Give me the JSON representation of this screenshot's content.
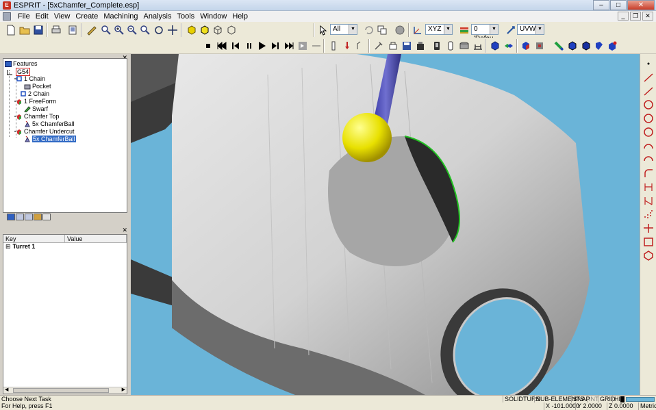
{
  "window": {
    "title": "ESPRIT - [5xChamfer_Complete.esp]",
    "app_icon": "E"
  },
  "menu": [
    "File",
    "Edit",
    "View",
    "Create",
    "Machining",
    "Analysis",
    "Tools",
    "Window",
    "Help"
  ],
  "toolbar1": {
    "select_filter": "All",
    "plane": "XYZ",
    "layer": "0 'Defau",
    "work_coord": "UVW"
  },
  "features_panel": {
    "title": "Features",
    "items": [
      {
        "label": "G54",
        "level": 0,
        "icon": "csys-icon"
      },
      {
        "label": "1 Chain",
        "level": 1,
        "icon": "chain-icon"
      },
      {
        "label": "Pocket",
        "level": 2,
        "icon": "pocket-op-icon"
      },
      {
        "label": "2 Chain",
        "level": 1,
        "icon": "chain-icon"
      },
      {
        "label": "1 FreeForm",
        "level": 1,
        "icon": "freeform-icon"
      },
      {
        "label": "Swarf",
        "level": 2,
        "icon": "swarf-op-icon"
      },
      {
        "label": "Chamfer Top",
        "level": 1,
        "icon": "freeform-icon"
      },
      {
        "label": "5x ChamferBall",
        "level": 2,
        "icon": "chamfer-op-icon"
      },
      {
        "label": "Chamfer Undercut",
        "level": 1,
        "icon": "freeform-icon"
      },
      {
        "label": "5x ChamferBall",
        "level": 2,
        "icon": "chamfer-op-icon",
        "selected": true
      }
    ]
  },
  "properties_panel": {
    "columns": [
      "Key",
      "Value"
    ],
    "rows": [
      {
        "key": "Turret 1",
        "value": ""
      }
    ]
  },
  "status": {
    "prompt": "Choose Next Task",
    "help": "For Help, press F1",
    "modes": [
      "SOLIDTURN",
      "SUB-ELEMENTS",
      "SNAP",
      "INT",
      "GRID",
      "HI"
    ],
    "x": "X -101.0000",
    "y": "Y 2.0000",
    "z": "Z 0.0000",
    "units": "Metric"
  },
  "colors": {
    "viewport_bg": "#6ab4d8",
    "part": "#c8c8c8",
    "tool_shank": "#4a4aa0",
    "tool_ball": "#e8e000",
    "toolpath": "#20c020",
    "selection": "#316ac5"
  }
}
